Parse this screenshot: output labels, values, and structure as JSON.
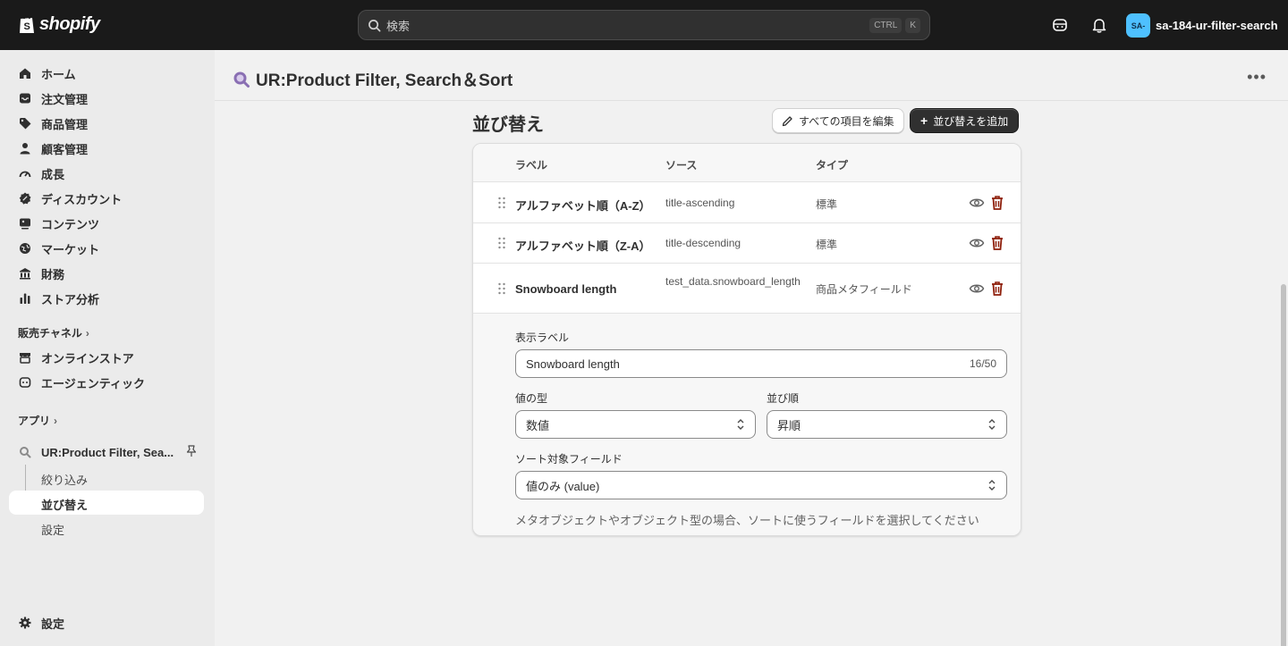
{
  "topbar": {
    "logo_text": "shopify",
    "search_placeholder": "検索",
    "shortcut_key1": "CTRL",
    "shortcut_key2": "K",
    "store_avatar": "SA-",
    "store_name": "sa-184-ur-filter-search"
  },
  "sidebar": {
    "items": [
      {
        "label": "ホーム",
        "icon": "home-icon"
      },
      {
        "label": "注文管理",
        "icon": "inbox-icon"
      },
      {
        "label": "商品管理",
        "icon": "tag-icon"
      },
      {
        "label": "顧客管理",
        "icon": "person-icon"
      },
      {
        "label": "成長",
        "icon": "gauge-icon"
      },
      {
        "label": "ディスカウント",
        "icon": "discount-icon"
      },
      {
        "label": "コンテンツ",
        "icon": "content-icon"
      },
      {
        "label": "マーケット",
        "icon": "globe-icon"
      },
      {
        "label": "財務",
        "icon": "bank-icon"
      },
      {
        "label": "ストア分析",
        "icon": "chart-icon"
      }
    ],
    "sales_channels_label": "販売チャネル",
    "channels": [
      {
        "label": "オンラインストア",
        "icon": "store-icon"
      },
      {
        "label": "エージェンティック",
        "icon": "agentic-icon"
      }
    ],
    "apps_label": "アプリ",
    "app_name": "UR:Product Filter, Sea...",
    "app_sub": [
      "絞り込み",
      "並び替え",
      "設定"
    ],
    "settings_label": "設定"
  },
  "header": {
    "app_title": "UR:Product Filter, Search＆Sort",
    "more": "•••"
  },
  "page": {
    "title": "並び替え",
    "edit_all_button": "すべての項目を編集",
    "add_sort_button": "並び替えを追加"
  },
  "table": {
    "columns": [
      "ラベル",
      "ソース",
      "タイプ"
    ],
    "rows": [
      {
        "label": "アルファベット順（A-Z）",
        "source": "title-ascending",
        "type": "標準"
      },
      {
        "label": "アルファベット順（Z-A）",
        "source": "title-descending",
        "type": "標準"
      },
      {
        "label": "Snowboard length",
        "source": "test_data.snowboard_length",
        "type": "商品メタフィールド"
      }
    ]
  },
  "detail": {
    "display_label_title": "表示ラベル",
    "display_label_value": "Snowboard length",
    "display_label_counter": "16/50",
    "value_type_title": "値の型",
    "value_type_value": "数値",
    "order_title": "並び順",
    "order_value": "昇順",
    "sort_field_title": "ソート対象フィールド",
    "sort_field_value": "値のみ (value)",
    "help_text": "メタオブジェクトやオブジェクト型の場合、ソートに使うフィールドを選択してください"
  },
  "colors": {
    "topbar_bg": "#1a1a1a",
    "primary_button": "#303030",
    "danger": "#8e1f0b",
    "app_icon": "#8a6fb3"
  }
}
